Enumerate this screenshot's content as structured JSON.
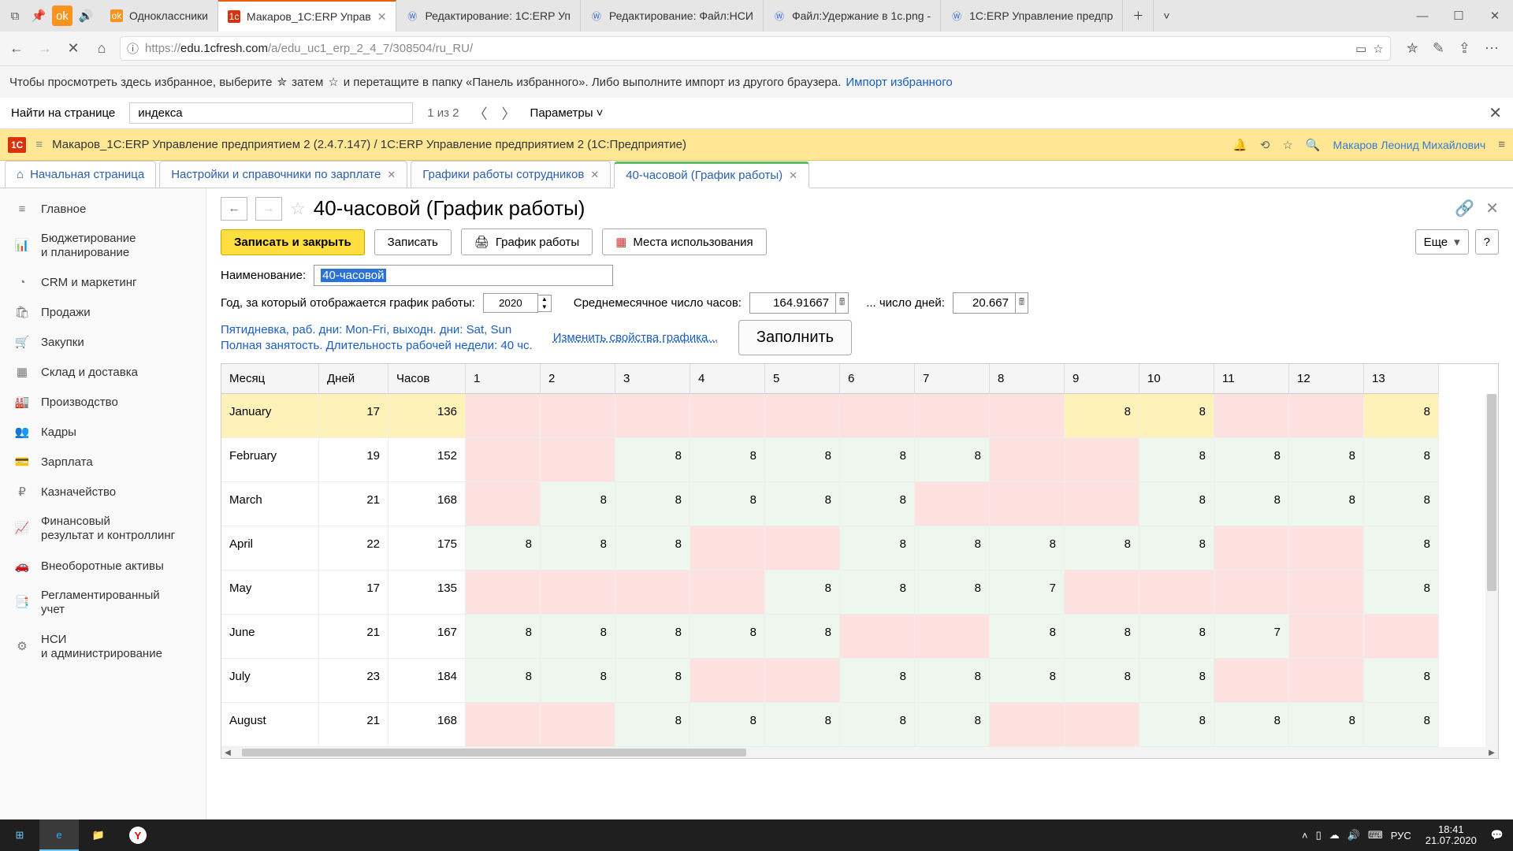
{
  "browser": {
    "tabs": [
      {
        "label": "Одноклассники"
      },
      {
        "label": "Макаров_1С:ERP Управ",
        "active": true
      },
      {
        "label": "Редактирование: 1С:ERP Уп"
      },
      {
        "label": "Редактирование: Файл:НСИ"
      },
      {
        "label": "Файл:Удержание в 1с.png -"
      },
      {
        "label": "1С:ERP Управление предпр"
      }
    ],
    "url_prefix": "https://",
    "url_host": "edu.1cfresh.com",
    "url_path": "/a/edu_uc1_erp_2_4_7/308504/ru_RU/",
    "bookmark_text": "Чтобы просмотреть здесь избранное, выберите ",
    "bookmark_mid": " затем ",
    "bookmark_tail": " и перетащите в папку «Панель избранного». Либо выполните импорт из другого браузера. ",
    "import_link": "Импорт избранного"
  },
  "find": {
    "label": "Найти на странице",
    "value": "индекса",
    "count": "1 из 2",
    "params": "Параметры"
  },
  "app": {
    "title": "Макаров_1С:ERP Управление предприятием 2 (2.4.7.147) / 1С:ERP Управление предприятием 2   (1С:Предприятие)",
    "user": "Макаров Леонид Михайлович"
  },
  "form_tabs": [
    {
      "label": "Начальная страница",
      "home": true
    },
    {
      "label": "Настройки и справочники по зарплате"
    },
    {
      "label": "Графики работы сотрудников"
    },
    {
      "label": "40-часовой (График работы)",
      "active": true
    }
  ],
  "sidebar": [
    {
      "icon": "≡",
      "label": "Главное"
    },
    {
      "icon": "📊",
      "label": "Бюджетирование\nи планирование"
    },
    {
      "icon": "◔",
      "label": "CRM и маркетинг"
    },
    {
      "icon": "🛍",
      "label": "Продажи"
    },
    {
      "icon": "🛒",
      "label": "Закупки"
    },
    {
      "icon": "▦",
      "label": "Склад и доставка"
    },
    {
      "icon": "🏭",
      "label": "Производство"
    },
    {
      "icon": "👥",
      "label": "Кадры"
    },
    {
      "icon": "💳",
      "label": "Зарплата"
    },
    {
      "icon": "₽",
      "label": "Казначейство"
    },
    {
      "icon": "📈",
      "label": "Финансовый\nрезультат и контроллинг"
    },
    {
      "icon": "🚗",
      "label": "Внеоборотные активы"
    },
    {
      "icon": "📑",
      "label": "Регламентированный\nучет"
    },
    {
      "icon": "⚙",
      "label": "НСИ\nи администрирование"
    }
  ],
  "page": {
    "title": "40-часовой (График работы)",
    "btn_save_close": "Записать и закрыть",
    "btn_save": "Записать",
    "btn_chart": "График работы",
    "btn_places": "Места использования",
    "btn_more": "Еще",
    "btn_help": "?",
    "name_label": "Наименование:",
    "name_value": "40-часовой",
    "year_label": "Год, за который отображается график работы:",
    "year_value": "2020",
    "avg_hours_label": "Среднемесячное число часов:",
    "avg_hours_value": "164.91667",
    "avg_days_label": "... число дней:",
    "avg_days_value": "20.667",
    "desc1": "Пятидневка, раб. дни: Mon-Fri, выходн. дни: Sat, Sun",
    "desc2": "Полная занятость. Длительность рабочей недели: 40 чс.",
    "change_link": "Изменить свойства графика...",
    "fill_btn": "Заполнить"
  },
  "grid": {
    "headers": [
      "Месяц",
      "Дней",
      "Часов",
      "1",
      "2",
      "3",
      "4",
      "5",
      "6",
      "7",
      "8",
      "9",
      "10",
      "11",
      "12",
      "13"
    ],
    "rows": [
      {
        "m": "January",
        "d": "17",
        "h": "136",
        "sel": true,
        "cells": [
          {
            "t": "wknd"
          },
          {
            "t": "wknd"
          },
          {
            "t": "wknd"
          },
          {
            "t": "wknd"
          },
          {
            "t": "wknd"
          },
          {
            "t": "wknd"
          },
          {
            "t": "wknd"
          },
          {
            "t": "wknd"
          },
          {
            "v": "8",
            "t": "work"
          },
          {
            "v": "8",
            "t": "work"
          },
          {
            "t": "wknd"
          },
          {
            "t": "wknd"
          },
          {
            "v": "8",
            "t": "work"
          }
        ]
      },
      {
        "m": "February",
        "d": "19",
        "h": "152",
        "cells": [
          {
            "t": "wknd"
          },
          {
            "t": "wknd"
          },
          {
            "v": "8",
            "t": "work"
          },
          {
            "v": "8",
            "t": "work"
          },
          {
            "v": "8",
            "t": "work"
          },
          {
            "v": "8",
            "t": "work"
          },
          {
            "v": "8",
            "t": "work"
          },
          {
            "t": "wknd"
          },
          {
            "t": "wknd"
          },
          {
            "v": "8",
            "t": "work"
          },
          {
            "v": "8",
            "t": "work"
          },
          {
            "v": "8",
            "t": "work"
          },
          {
            "v": "8",
            "t": "work"
          }
        ]
      },
      {
        "m": "March",
        "d": "21",
        "h": "168",
        "cells": [
          {
            "t": "wknd"
          },
          {
            "v": "8",
            "t": "work"
          },
          {
            "v": "8",
            "t": "work"
          },
          {
            "v": "8",
            "t": "work"
          },
          {
            "v": "8",
            "t": "work"
          },
          {
            "v": "8",
            "t": "work"
          },
          {
            "t": "wknd"
          },
          {
            "t": "wknd"
          },
          {
            "t": "wknd"
          },
          {
            "v": "8",
            "t": "work"
          },
          {
            "v": "8",
            "t": "work"
          },
          {
            "v": "8",
            "t": "work"
          },
          {
            "v": "8",
            "t": "work"
          }
        ]
      },
      {
        "m": "April",
        "d": "22",
        "h": "175",
        "cells": [
          {
            "v": "8",
            "t": "work"
          },
          {
            "v": "8",
            "t": "work"
          },
          {
            "v": "8",
            "t": "work"
          },
          {
            "t": "wknd"
          },
          {
            "t": "wknd"
          },
          {
            "v": "8",
            "t": "work"
          },
          {
            "v": "8",
            "t": "work"
          },
          {
            "v": "8",
            "t": "work"
          },
          {
            "v": "8",
            "t": "work"
          },
          {
            "v": "8",
            "t": "work"
          },
          {
            "t": "wknd"
          },
          {
            "t": "wknd"
          },
          {
            "v": "8",
            "t": "work"
          }
        ]
      },
      {
        "m": "May",
        "d": "17",
        "h": "135",
        "cells": [
          {
            "t": "wknd"
          },
          {
            "t": "wknd"
          },
          {
            "t": "wknd"
          },
          {
            "t": "wknd"
          },
          {
            "v": "8",
            "t": "work"
          },
          {
            "v": "8",
            "t": "work"
          },
          {
            "v": "8",
            "t": "work"
          },
          {
            "v": "7",
            "t": "work"
          },
          {
            "t": "wknd"
          },
          {
            "t": "wknd"
          },
          {
            "t": "wknd"
          },
          {
            "t": "wknd"
          },
          {
            "v": "8",
            "t": "work"
          }
        ]
      },
      {
        "m": "June",
        "d": "21",
        "h": "167",
        "cells": [
          {
            "v": "8",
            "t": "work"
          },
          {
            "v": "8",
            "t": "work"
          },
          {
            "v": "8",
            "t": "work"
          },
          {
            "v": "8",
            "t": "work"
          },
          {
            "v": "8",
            "t": "work"
          },
          {
            "t": "wknd"
          },
          {
            "t": "wknd"
          },
          {
            "v": "8",
            "t": "work"
          },
          {
            "v": "8",
            "t": "work"
          },
          {
            "v": "8",
            "t": "work"
          },
          {
            "v": "7",
            "t": "work"
          },
          {
            "t": "wknd"
          },
          {
            "t": "wknd"
          }
        ]
      },
      {
        "m": "July",
        "d": "23",
        "h": "184",
        "cells": [
          {
            "v": "8",
            "t": "work"
          },
          {
            "v": "8",
            "t": "work"
          },
          {
            "v": "8",
            "t": "work"
          },
          {
            "t": "wknd"
          },
          {
            "t": "wknd"
          },
          {
            "v": "8",
            "t": "work"
          },
          {
            "v": "8",
            "t": "work"
          },
          {
            "v": "8",
            "t": "work"
          },
          {
            "v": "8",
            "t": "work"
          },
          {
            "v": "8",
            "t": "work"
          },
          {
            "t": "wknd"
          },
          {
            "t": "wknd"
          },
          {
            "v": "8",
            "t": "work"
          }
        ]
      },
      {
        "m": "August",
        "d": "21",
        "h": "168",
        "cells": [
          {
            "t": "wknd"
          },
          {
            "t": "wknd"
          },
          {
            "v": "8",
            "t": "work"
          },
          {
            "v": "8",
            "t": "work"
          },
          {
            "v": "8",
            "t": "work"
          },
          {
            "v": "8",
            "t": "work"
          },
          {
            "v": "8",
            "t": "work"
          },
          {
            "t": "wknd"
          },
          {
            "t": "wknd"
          },
          {
            "v": "8",
            "t": "work"
          },
          {
            "v": "8",
            "t": "work"
          },
          {
            "v": "8",
            "t": "work"
          },
          {
            "v": "8",
            "t": "work"
          }
        ]
      }
    ]
  },
  "taskbar": {
    "lang": "РУС",
    "time": "18:41",
    "date": "21.07.2020"
  }
}
